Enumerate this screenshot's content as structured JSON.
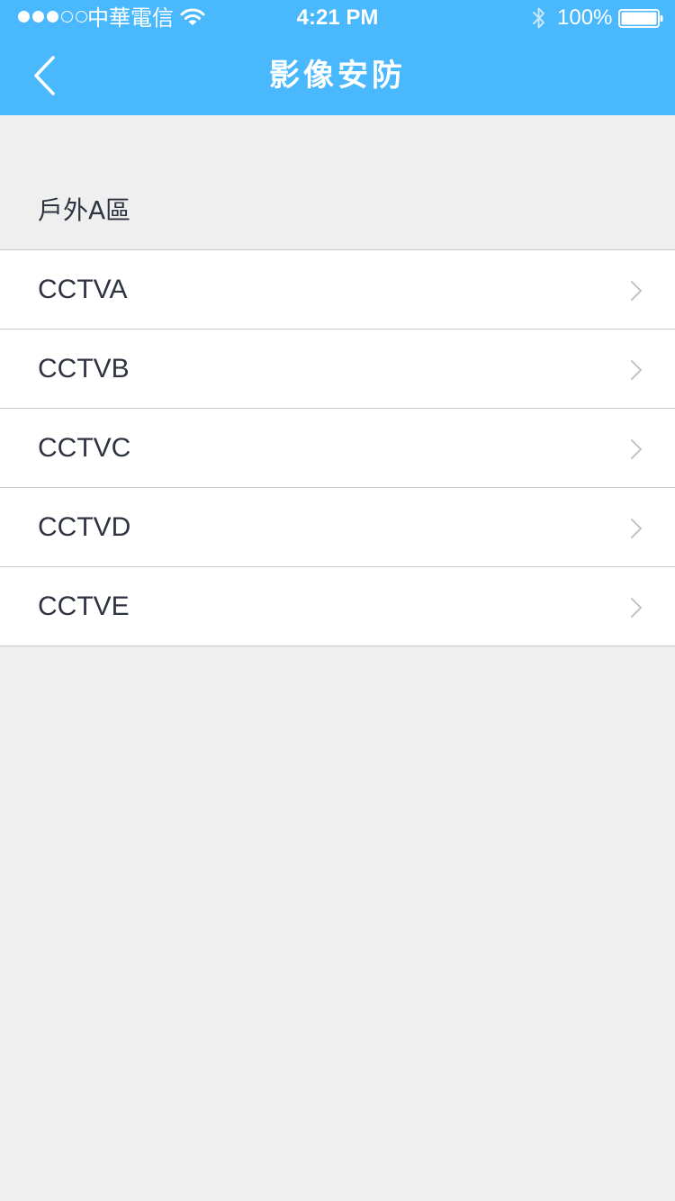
{
  "status_bar": {
    "carrier": "中華電信",
    "time": "4:21 PM",
    "battery": "100%",
    "signal_bars_filled": 3,
    "signal_bars_total": 5
  },
  "nav": {
    "title": "影像安防",
    "back_icon": "chevron-left-icon"
  },
  "section": {
    "header": "戶外A區"
  },
  "list": {
    "items": [
      {
        "label": "CCTVA"
      },
      {
        "label": "CCTVB"
      },
      {
        "label": "CCTVC"
      },
      {
        "label": "CCTVD"
      },
      {
        "label": "CCTVE"
      }
    ],
    "item_icon": "chevron-right-icon"
  },
  "colors": {
    "primary": "#49b8fd",
    "background": "#efefef",
    "text": "#2d3340",
    "separator": "#c8c8cc",
    "chevron": "#c4c4c8"
  }
}
